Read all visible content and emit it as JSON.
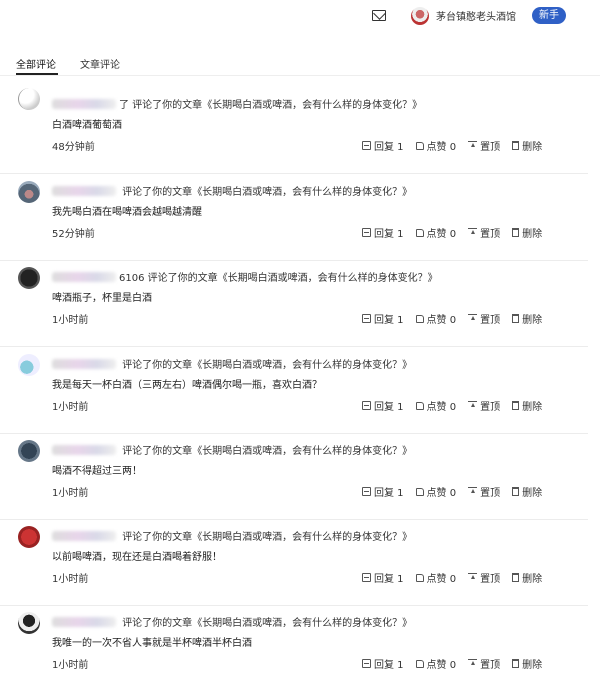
{
  "header": {
    "user_name": "茅台镇憨老头酒馆",
    "badge": "新手"
  },
  "tabs": [
    {
      "label": "全部评论"
    },
    {
      "label": "文章评论"
    }
  ],
  "comments": [
    {
      "id_suffix": "了",
      "action": "评论了你的文章",
      "article": "《长期喝白酒或啤酒，会有什么样的身体变化？》",
      "text": "白酒啤酒葡萄酒",
      "time": "48分钟前",
      "reply": "回复 1",
      "like": "点赞 0",
      "pin": "置顶",
      "del": "删除"
    },
    {
      "id_suffix": "",
      "action": "评论了你的文章",
      "article": "《长期喝白酒或啤酒，会有什么样的身体变化？》",
      "text": "我先喝白酒在喝啤酒会越喝越清醒",
      "time": "52分钟前",
      "reply": "回复 1",
      "like": "点赞 0",
      "pin": "置顶",
      "del": "删除"
    },
    {
      "id_suffix": "6106",
      "action": "评论了你的文章",
      "article": "《长期喝白酒或啤酒，会有什么样的身体变化？》",
      "text": "啤酒瓶子，杯里是白酒",
      "time": "1小时前",
      "reply": "回复 1",
      "like": "点赞 0",
      "pin": "置顶",
      "del": "删除"
    },
    {
      "id_suffix": "",
      "action": "评论了你的文章",
      "article": "《长期喝白酒或啤酒，会有什么样的身体变化？》",
      "text": "我是每天一杯白酒（三两左右）啤酒偶尔喝一瓶，喜欢白酒？",
      "time": "1小时前",
      "reply": "回复 1",
      "like": "点赞 0",
      "pin": "置顶",
      "del": "删除"
    },
    {
      "id_suffix": "",
      "action": "评论了你的文章",
      "article": "《长期喝白酒或啤酒，会有什么样的身体变化？》",
      "text": "喝酒不得超过三两！",
      "time": "1小时前",
      "reply": "回复 1",
      "like": "点赞 0",
      "pin": "置顶",
      "del": "删除"
    },
    {
      "id_suffix": "",
      "action": "评论了你的文章",
      "article": "《长期喝白酒或啤酒，会有什么样的身体变化？》",
      "text": "以前喝啤酒，现在还是白酒喝着舒服！",
      "time": "1小时前",
      "reply": "回复 1",
      "like": "点赞 0",
      "pin": "置顶",
      "del": "删除"
    },
    {
      "id_suffix": "",
      "action": "评论了你的文章",
      "article": "《长期喝白酒或啤酒，会有什么样的身体变化？》",
      "text": "我唯一的一次不省人事就是半杯啤酒半杯白酒",
      "time": "1小时前",
      "reply": "回复 1",
      "like": "点赞 0",
      "pin": "置顶",
      "del": "删除"
    }
  ]
}
